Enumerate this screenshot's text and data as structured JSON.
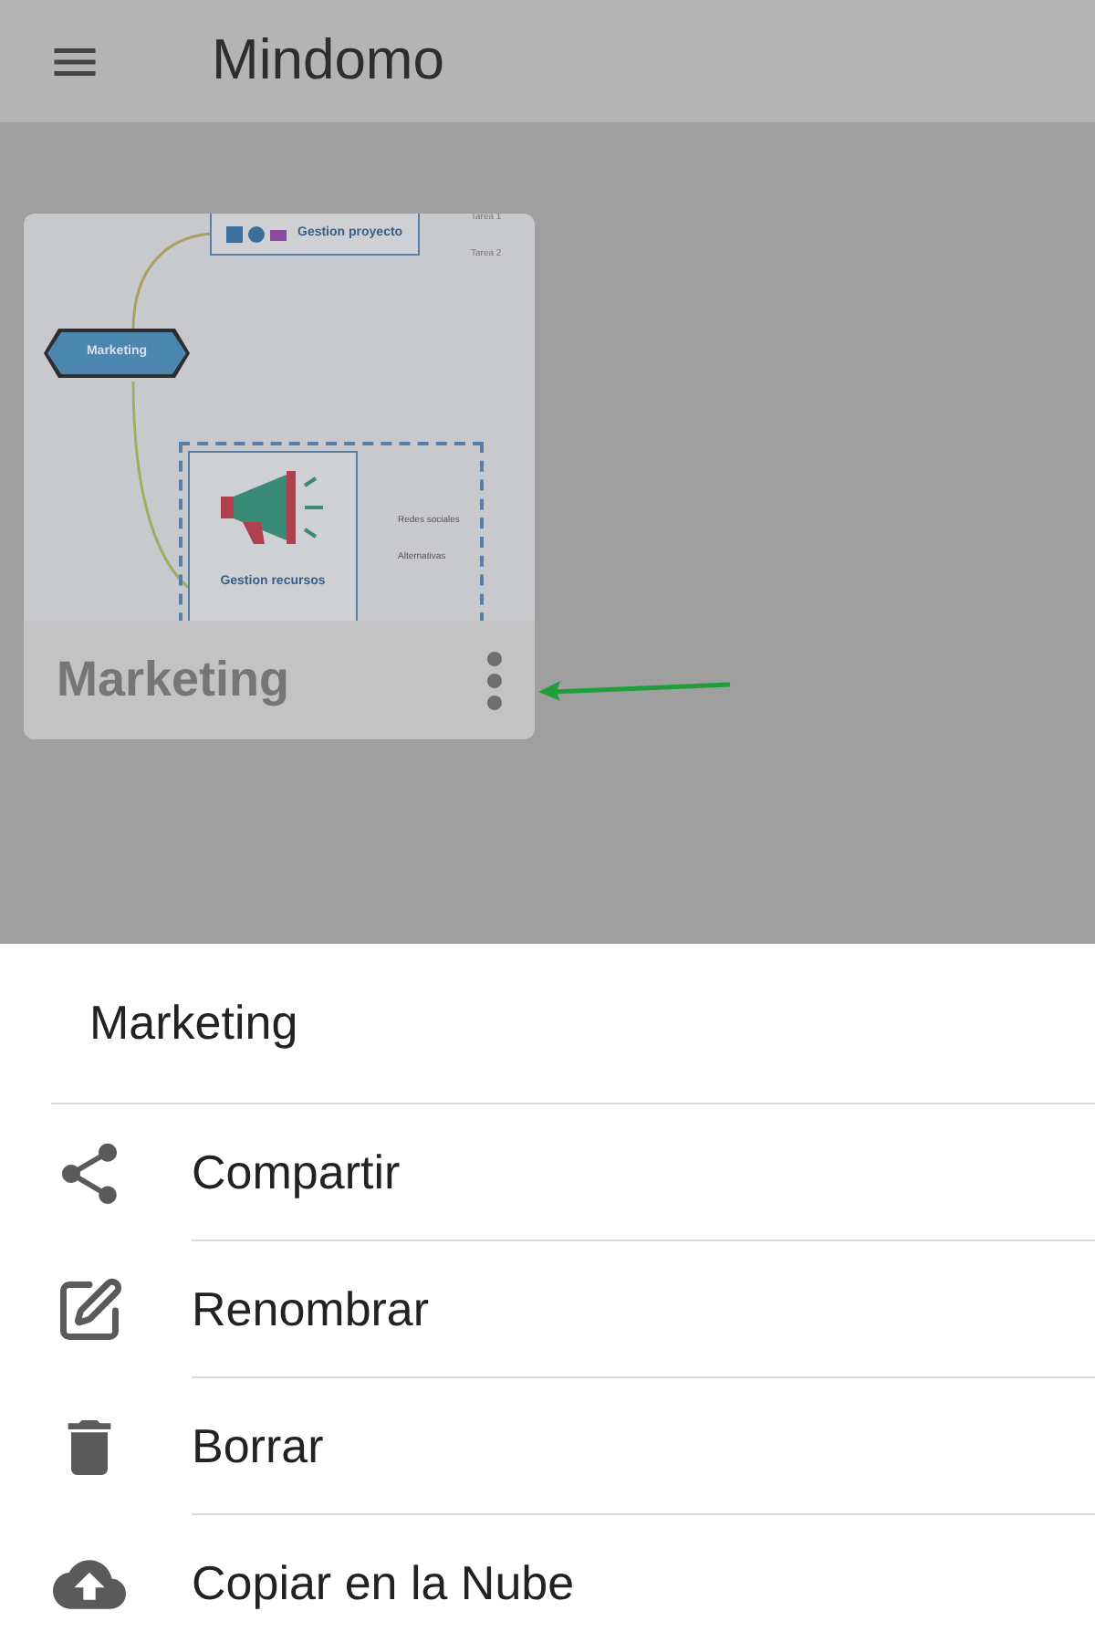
{
  "app_bar": {
    "title": "Mindomo"
  },
  "maps": [
    {
      "title": "Marketing",
      "preview": {
        "central": "Marketing",
        "project_node": "Gestion proyecto",
        "tasks": [
          "Tarea 1",
          "Tarea 2"
        ],
        "resource_node": "Gestion recursos",
        "resource_items": [
          "Redes sociales",
          "Alternativas"
        ]
      }
    }
  ],
  "sheet": {
    "title": "Marketing",
    "actions": [
      {
        "label": "Compartir",
        "kind": "share"
      },
      {
        "label": "Renombrar",
        "kind": "rename"
      },
      {
        "label": "Borrar",
        "kind": "delete"
      },
      {
        "label": "Copiar en la Nube",
        "kind": "cloud"
      }
    ]
  }
}
